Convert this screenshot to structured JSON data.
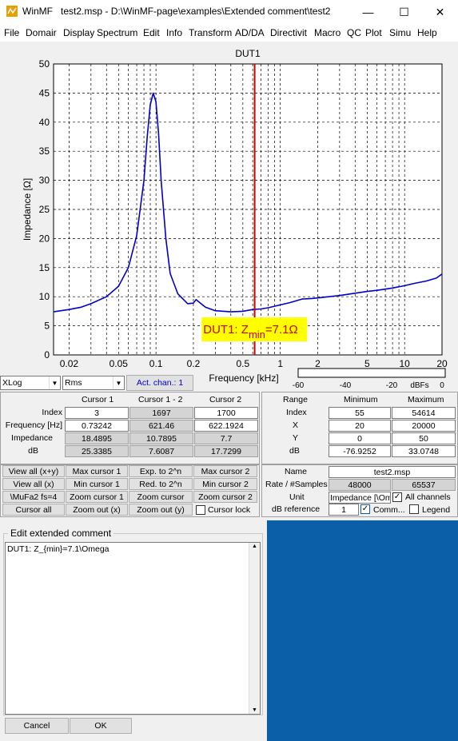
{
  "window": {
    "app": "WinMF",
    "title": "test2.msp - D:\\WinMF-page\\examples\\Extended comment\\test2",
    "minimize": "—",
    "maximize": "☐",
    "close": "✕"
  },
  "menu": [
    "File",
    "Domair",
    "Display",
    "Spectrum",
    "Edit",
    "Info",
    "Transform",
    "AD/DA",
    "Directivit",
    "Macro",
    "QC",
    "Plot",
    "Simu",
    "Help"
  ],
  "chart_data": {
    "type": "line",
    "title": "DUT1",
    "xlabel": "Frequency [kHz]",
    "ylabel": "Impedance [Ω]",
    "xscale": "log",
    "xlim": [
      0.015,
      20
    ],
    "ylim": [
      0,
      50
    ],
    "grid": true,
    "xtick_labels": [
      "0.02",
      "0.05",
      "0.1",
      "0.2",
      "0.5",
      "1",
      "2",
      "5",
      "10",
      "20"
    ],
    "xtick_values": [
      0.02,
      0.05,
      0.1,
      0.2,
      0.5,
      1,
      2,
      5,
      10,
      20
    ],
    "ytick_labels": [
      "0",
      "5",
      "10",
      "15",
      "20",
      "25",
      "30",
      "35",
      "40",
      "45",
      "50"
    ],
    "ytick_values": [
      0,
      5,
      10,
      15,
      20,
      25,
      30,
      35,
      40,
      45,
      50
    ],
    "cursor_x": 0.622,
    "series": [
      {
        "color": "#0000cc",
        "x": [
          0.015,
          0.02,
          0.025,
          0.03,
          0.04,
          0.05,
          0.06,
          0.07,
          0.08,
          0.085,
          0.09,
          0.095,
          0.1,
          0.105,
          0.11,
          0.12,
          0.13,
          0.15,
          0.18,
          0.2,
          0.21,
          0.25,
          0.3,
          0.4,
          0.5,
          0.6,
          0.7,
          0.8,
          1.0,
          1.2,
          1.5,
          1.8,
          2,
          3,
          4,
          5,
          6,
          7,
          8,
          10,
          12,
          15,
          18,
          20
        ],
        "y": [
          7.4,
          7.8,
          8.2,
          8.8,
          10.0,
          11.8,
          15.0,
          20.5,
          30.0,
          37.5,
          43.0,
          45.0,
          43.5,
          38.0,
          30.0,
          20.0,
          14.0,
          10.5,
          8.8,
          8.9,
          9.5,
          8.2,
          7.6,
          7.4,
          7.5,
          7.8,
          7.9,
          8.1,
          8.6,
          9.0,
          9.6,
          9.7,
          9.8,
          10.2,
          10.6,
          10.9,
          11.1,
          11.3,
          11.5,
          11.9,
          12.3,
          12.7,
          13.2,
          13.9
        ]
      }
    ],
    "annotation": {
      "text": "DUT1: Z",
      "sub": "min",
      "rest": "=7.1Ω",
      "x": 0.24,
      "y": 3.7
    },
    "level_meter": {
      "ticks": [
        "-60",
        "-40",
        "-20",
        "dBFs",
        "0"
      ]
    }
  },
  "controls": {
    "xscale": "XLog",
    "mode": "Rms",
    "act_chan": "Act. chan.: 1"
  },
  "cursor_table": {
    "headers": [
      "Cursor 1",
      "Cursor 1 - 2",
      "Cursor 2"
    ],
    "rows": [
      {
        "label": "Index",
        "values": [
          "3",
          "1697",
          "1700"
        ]
      },
      {
        "label": "Frequency [Hz]",
        "values": [
          "0.73242",
          "621.46",
          "622.1924"
        ]
      },
      {
        "label": "Impedance",
        "values": [
          "18.4895",
          "10.7895",
          "7.7"
        ]
      },
      {
        "label": "dB",
        "values": [
          "25.3385",
          "7.6087",
          "17.7299"
        ]
      }
    ]
  },
  "range_table": {
    "headers": [
      "Range",
      "Minimum",
      "Maximum"
    ],
    "rows": [
      {
        "label": "Index",
        "values": [
          "55",
          "54614"
        ]
      },
      {
        "label": "X",
        "values": [
          "20",
          "20000"
        ]
      },
      {
        "label": "Y",
        "values": [
          "0",
          "50"
        ]
      },
      {
        "label": "dB",
        "values": [
          "-76.9252",
          "33.0748"
        ]
      }
    ]
  },
  "nav_buttons": [
    [
      "View all (x+y)",
      "Max cursor 1",
      "Exp. to 2^n",
      "Max cursor 2"
    ],
    [
      "View all (x)",
      "Min cursor 1",
      "Red. to 2^n",
      "Min cursor 2"
    ],
    [
      "\\MuFa2 fs=4",
      "Zoom cursor 1",
      "Zoom cursor",
      "Zoom cursor 2"
    ],
    [
      "Cursor all",
      "Zoom out (x)",
      "Zoom out (y)"
    ]
  ],
  "cursor_lock": "Cursor lock",
  "info": {
    "name_label": "Name",
    "name": "test2.msp",
    "rate_label": "Rate / #Samples",
    "rate": "48000",
    "samples": "65537",
    "unit_label": "Unit",
    "unit": "Impedance [\\Om",
    "all_channels": "All channels",
    "dbref_label": "dB reference",
    "dbref": "1",
    "comm": "Comm...",
    "legend": "Legend"
  },
  "comment": {
    "title": "Edit extended comment",
    "text": "DUT1: Z_{min}=7.1\\Omega",
    "cancel": "Cancel",
    "ok": "OK"
  },
  "colors": {
    "accent_blue": "#0b5ea8",
    "curve": "#0000cc",
    "cursor": "#cc0000",
    "annotation_bg": "#ffff00",
    "annotation_text": "#cc0000"
  }
}
